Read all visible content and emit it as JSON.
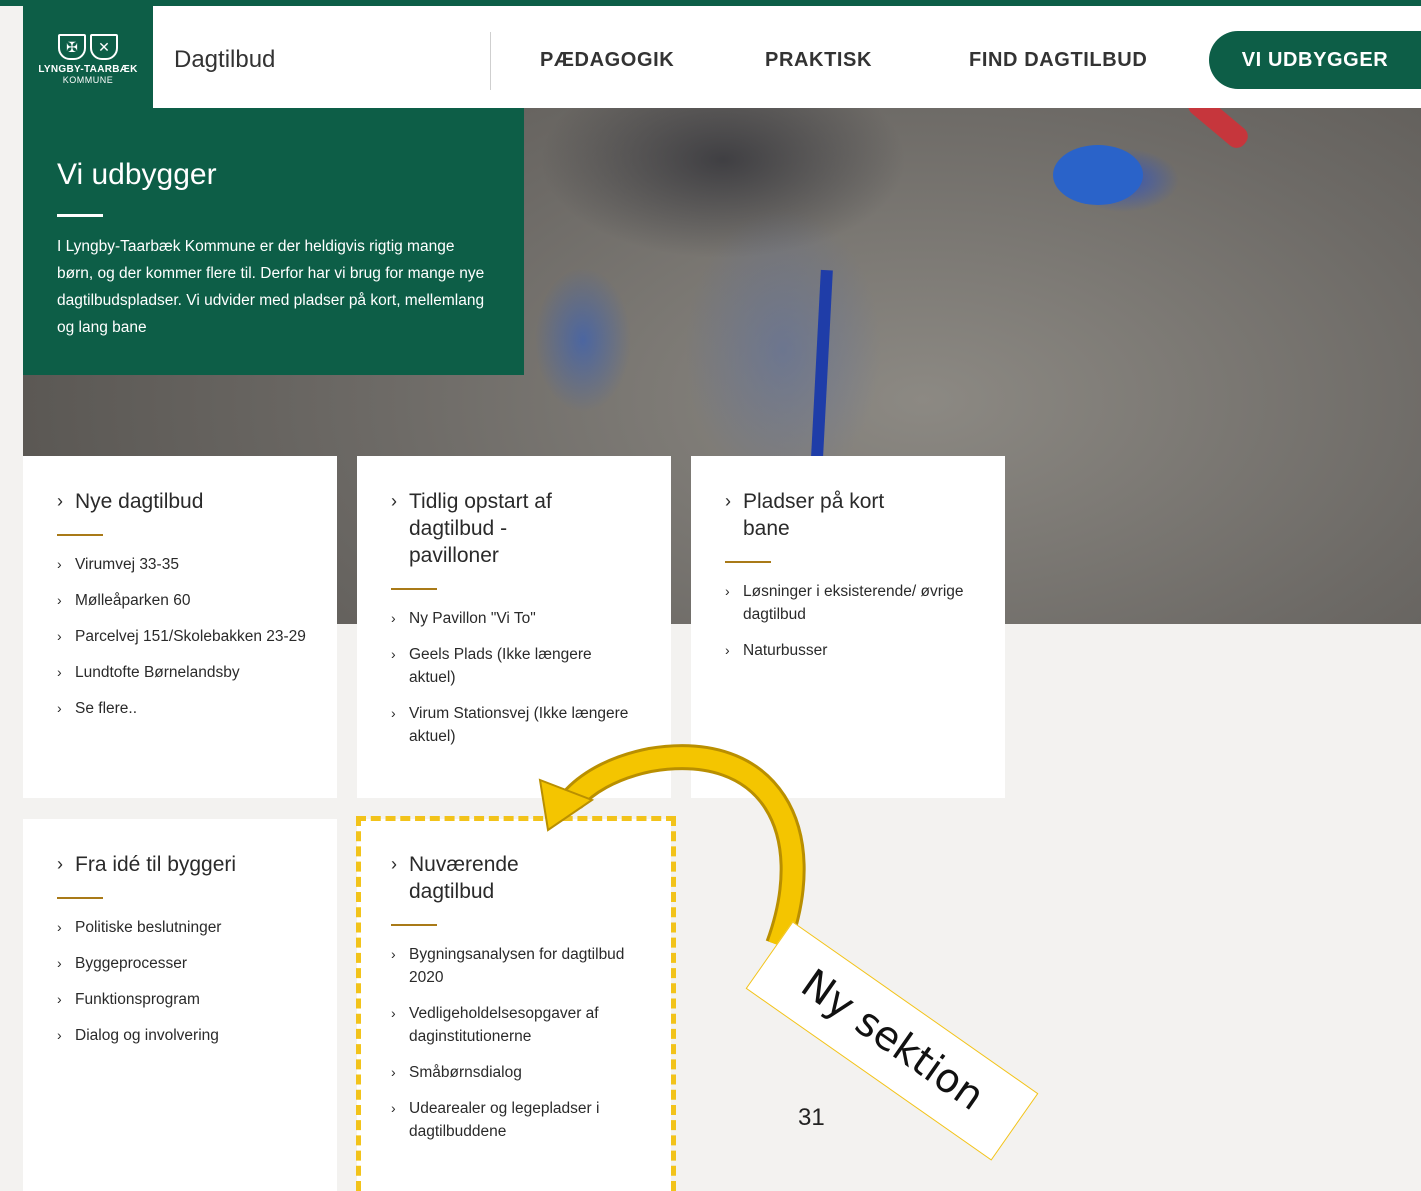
{
  "header": {
    "logo_line1": "LYNGBY-TAARBÆK",
    "logo_line2": "KOMMUNE",
    "site_title": "Dagtilbud",
    "nav": [
      "PÆDAGOGIK",
      "PRAKTISK",
      "FIND DAGTILBUD"
    ],
    "nav_active": "VI UDBYGGER"
  },
  "intro": {
    "title": "Vi udbygger",
    "text": "I Lyngby-Taarbæk Kommune er der heldigvis rigtig mange børn, og der kommer flere til. Derfor har vi brug for mange nye dagtilbudspladser. Vi udvider med pladser på kort, mellemlang og lang bane"
  },
  "cards": [
    {
      "title": "Nye dagtilbud",
      "items": [
        "Virumvej 33-35",
        "Mølleåparken 60",
        "Parcelvej 151/Skolebakken 23-29",
        "Lundtofte Børnelandsby",
        "Se flere.."
      ]
    },
    {
      "title": "Tidlig opstart af dagtilbud - pavilloner",
      "items": [
        "Ny Pavillon \"Vi To\"",
        "Geels Plads (Ikke længere aktuel)",
        "Virum Stationsvej (Ikke længere aktuel)"
      ]
    },
    {
      "title": "Pladser på kort bane",
      "items": [
        "Løsninger i eksisterende/ øvrige dagtilbud",
        "Naturbusser"
      ]
    },
    {
      "title": "Fra idé til byggeri",
      "items": [
        "Politiske beslutninger",
        "Byggeprocesser",
        "Funktionsprogram",
        "Dialog og involvering"
      ]
    },
    {
      "title": "Nuværende dagtilbud",
      "items": [
        "Bygningsanalysen for dagtilbud 2020",
        "Vedligeholdelsesopgaver af daginstitutionerne",
        "Småbørnsdialog",
        "Udearealer og legepladser i dagtilbuddene"
      ]
    }
  ],
  "annotation": {
    "tag_text": "Ny sektion",
    "highlight_color": "#f2c31a"
  },
  "page_number": "31",
  "colors": {
    "brand_green": "#0d5e47",
    "accent_gold": "#a97a18"
  }
}
